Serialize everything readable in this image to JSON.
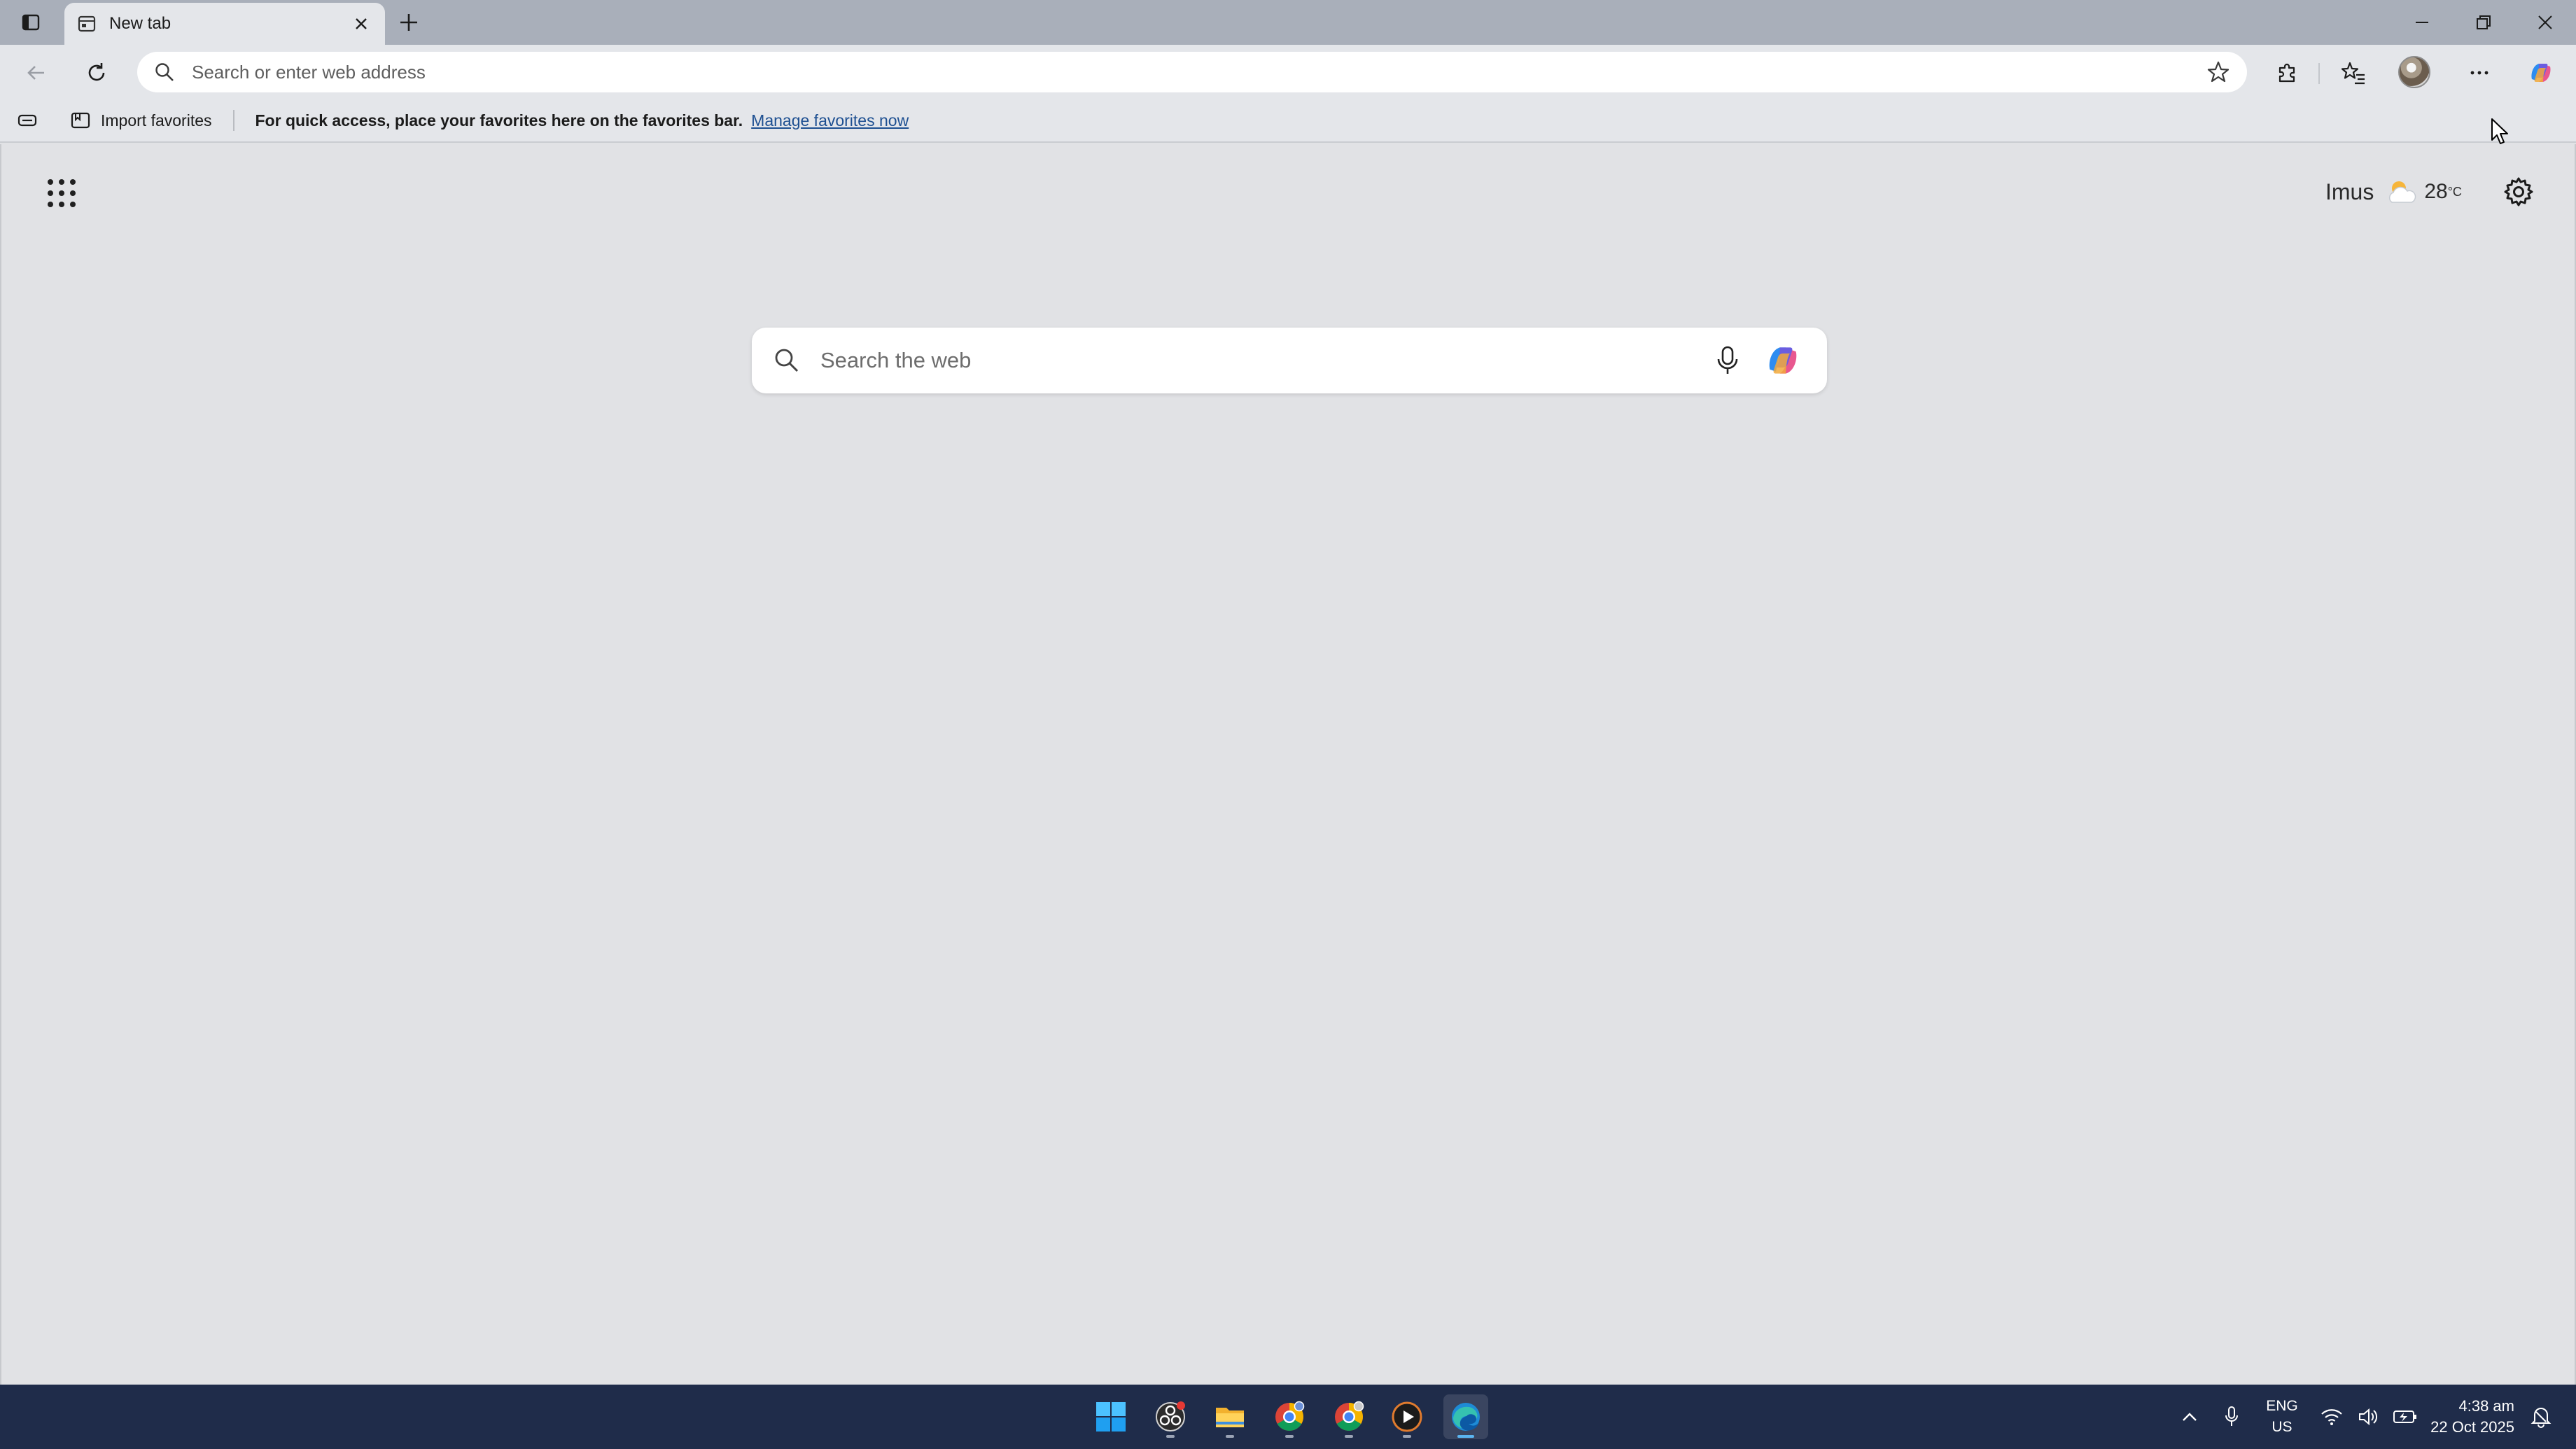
{
  "browser": {
    "tab": {
      "title": "New tab"
    },
    "address_bar": {
      "placeholder": "Search or enter web address"
    },
    "favorites_bar": {
      "import_label": "Import favorites",
      "hint": "For quick access, place your favorites here on the favorites bar.",
      "manage_link": "Manage favorites now"
    }
  },
  "new_tab_page": {
    "weather": {
      "location": "Imus",
      "temperature": "28",
      "unit": "°C"
    },
    "search": {
      "placeholder": "Search the web"
    }
  },
  "taskbar": {
    "apps": [
      "start-icon",
      "obs-studio-icon",
      "file-explorer-icon",
      "chrome-icon",
      "chrome-profile-icon",
      "media-player-icon",
      "edge-icon"
    ],
    "tray": {
      "language_line1": "ENG",
      "language_line2": "US",
      "time": "4:38 am",
      "date": "22 Oct 2025"
    }
  },
  "colors": {
    "tabstrip": "#a9afba",
    "toolbar": "#e4e6ea",
    "page_background": "#e1e2e5",
    "taskbar": "#1f2c4a",
    "link": "#1d4f91"
  }
}
